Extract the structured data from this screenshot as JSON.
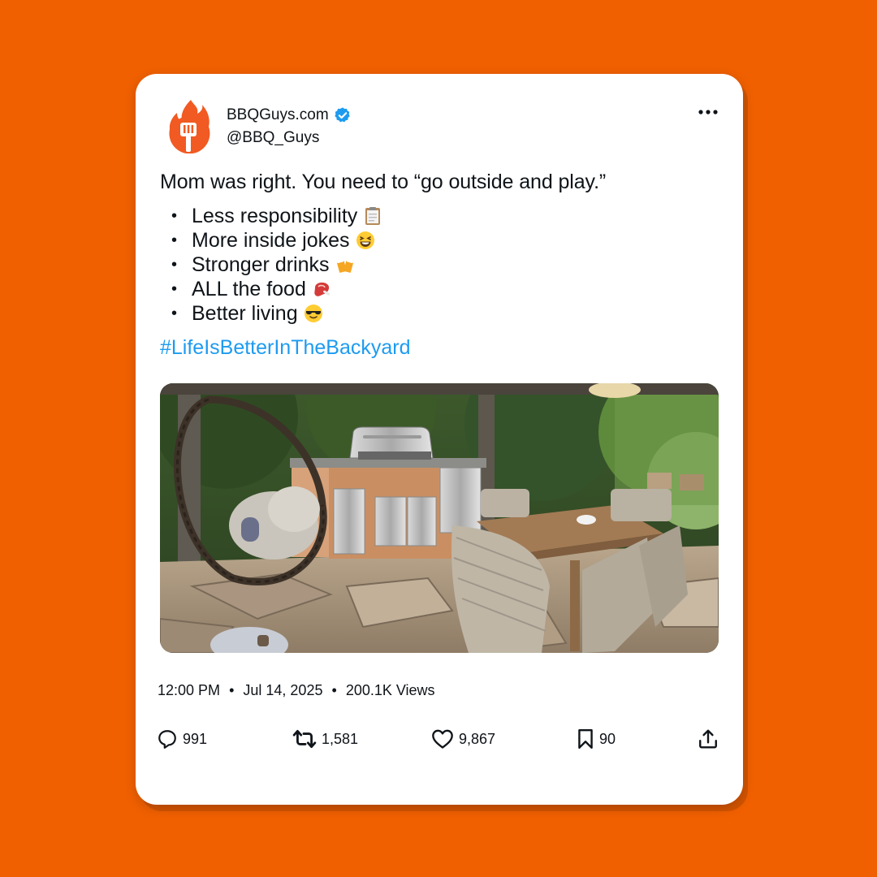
{
  "post": {
    "display_name": "BBQGuys.com",
    "handle": "@BBQ_Guys",
    "verified_icon": "verified-badge-icon",
    "lead_text": "Mom was right. You need to “go outside and play.”",
    "bullets": [
      {
        "text": "Less responsibility",
        "emoji": "clipboard-icon"
      },
      {
        "text": "More inside jokes",
        "emoji": "laughing-face-icon"
      },
      {
        "text": "Stronger drinks",
        "emoji": "clinking-beers-icon"
      },
      {
        "text": "ALL the food",
        "emoji": "steak-icon"
      },
      {
        "text": "Better living",
        "emoji": "sunglasses-face-icon"
      }
    ],
    "hashtag": "#LifeIsBetterInTheBackyard",
    "image_alt": "Backyard patio with outdoor kitchen grill, hanging egg chair and wicker dining set",
    "time": "12:00 PM",
    "date": "Jul 14, 2025",
    "views": "200.1K Views",
    "bullet_char": "•",
    "meta_sep": "•"
  },
  "actions": {
    "reply_count": "991",
    "repost_count": "1,581",
    "like_count": "9,867",
    "bookmark_count": "90"
  },
  "colors": {
    "background": "#f06000",
    "brand_orange": "#f15a22",
    "link_blue": "#1d9bf0",
    "text": "#0f1419"
  }
}
